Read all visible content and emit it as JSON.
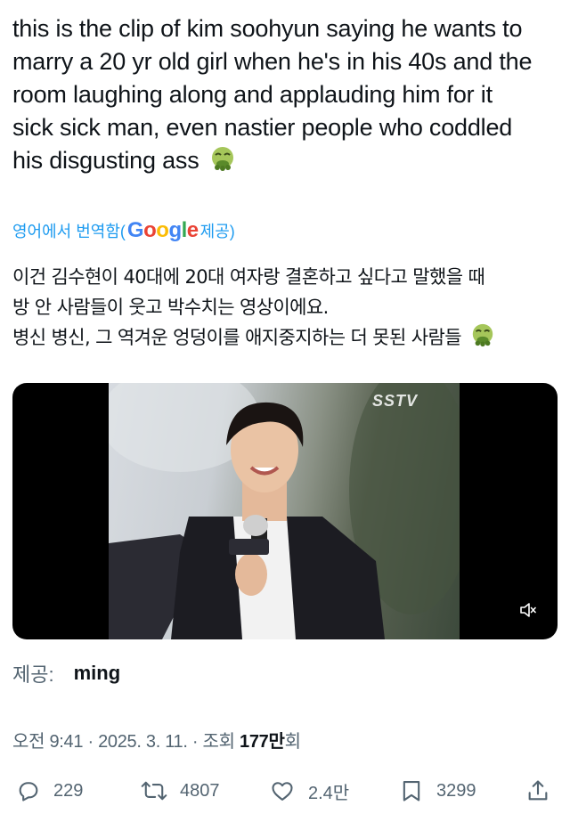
{
  "tweet": {
    "text_lines": [
      "this is the clip of kim soohyun saying he wants to",
      "marry a 20 yr old girl when he's in his 40s and the",
      "room laughing along and applauding him for it",
      "sick sick man, even nastier people who coddled",
      "his disgusting ass"
    ],
    "emoji": "nauseated-face-emoji"
  },
  "translation": {
    "prefix": "영어에서 번역함(",
    "provider": "Google",
    "suffix": " 제공)",
    "lines": [
      "이건 김수현이 40대에 20대 여자랑 결혼하고 싶다고 말했을 때",
      "방 안 사람들이 웃고 박수치는 영상이에요.",
      "병신 병신, 그 역겨운 엉덩이를 애지중지하는 더 못된 사람들"
    ]
  },
  "media": {
    "watermark": "SSTV",
    "mute_icon": "speaker-muted-icon"
  },
  "attribution": {
    "label": "제공:",
    "name": "ming"
  },
  "meta": {
    "time": "오전 9:41",
    "date": "2025. 3. 11.",
    "views_label": "조회",
    "views_count": "177만",
    "views_suffix": "회"
  },
  "actions": {
    "replies": "229",
    "reposts": "4807",
    "likes": "2.4만",
    "bookmarks": "3299"
  },
  "colors": {
    "text": "#0f1419",
    "muted": "#536471",
    "link": "#1d9bf0"
  }
}
